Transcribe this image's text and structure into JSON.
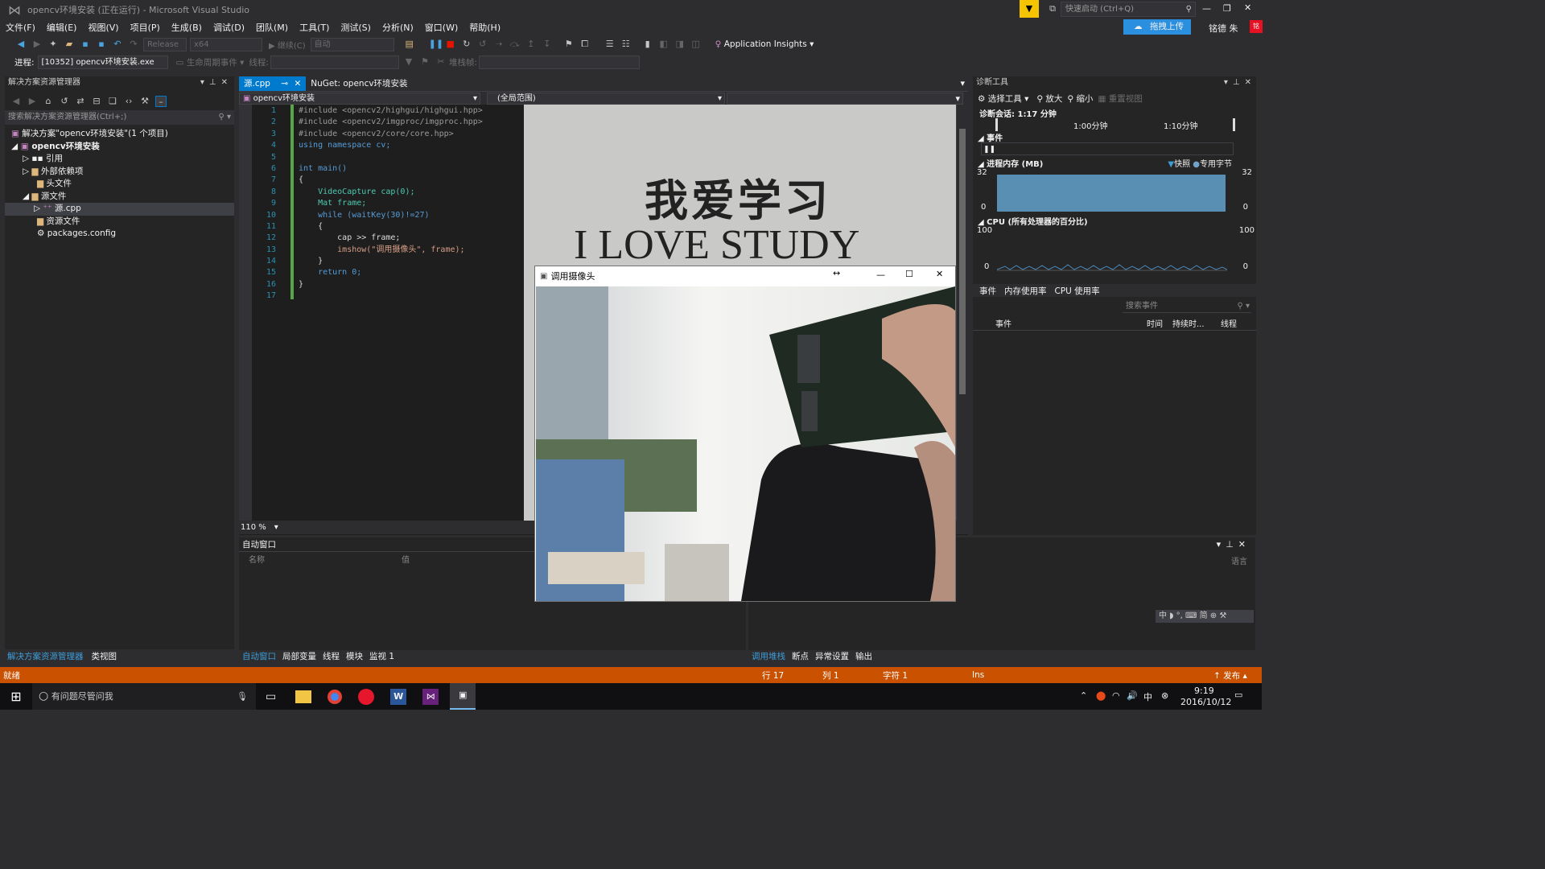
{
  "window_title": "opencv环境安装 (正在运行) - Microsoft Visual Studio",
  "quick_launch_placeholder": "快速启动 (Ctrl+Q)",
  "drag_upload": "拖拽上传",
  "user_name": "铭德 朱",
  "menu": [
    "文件(F)",
    "编辑(E)",
    "视图(V)",
    "项目(P)",
    "生成(B)",
    "调试(D)",
    "团队(M)",
    "工具(T)",
    "测试(S)",
    "分析(N)",
    "窗口(W)",
    "帮助(H)"
  ],
  "toolbar": {
    "config": "Release",
    "platform": "x64",
    "continue": "继续(C)",
    "auto": "自动",
    "app_insights": "Application Insights"
  },
  "toolbar2": {
    "process_label": "进程:",
    "process": "[10352] opencv环境安装.exe",
    "lifecycle": "生命周期事件",
    "thread": "线程:",
    "stack": "堆栈帧:"
  },
  "solution_explorer": {
    "title": "解决方案资源管理器",
    "search_placeholder": "搜索解决方案资源管理器(Ctrl+;)",
    "items": [
      "解决方案\"opencv环境安装\"(1 个项目)",
      "opencv环境安装",
      "引用",
      "外部依赖项",
      "头文件",
      "源文件",
      "源.cpp",
      "资源文件",
      "packages.config"
    ],
    "bottom_tabs": [
      "解决方案资源管理器",
      "类视图"
    ]
  },
  "editor": {
    "tabs": [
      "源.cpp",
      "NuGet: opencv环境安装"
    ],
    "nav_left": "opencv环境安装",
    "nav_right": "(全局范围)",
    "line_numbers": [
      "1",
      "2",
      "3",
      "4",
      "5",
      "6",
      "7",
      "8",
      "9",
      "10",
      "11",
      "12",
      "13",
      "14",
      "15",
      "16",
      "17"
    ],
    "code": [
      "#include <opencv2/highgui/highgui.hpp>",
      "#include <opencv2/imgproc/imgproc.hpp>",
      "#include <opencv2/core/core.hpp>",
      "using namespace cv;",
      "",
      "int main()",
      "{",
      "    VideoCapture cap(0);",
      "    Mat frame;",
      "    while (waitKey(30)!=27)",
      "    {",
      "        cap >> frame;",
      "        imshow(\"调用摄像头\", frame);",
      "    }",
      "    return 0;",
      "}",
      ""
    ],
    "zoom": "110 %"
  },
  "image_text": {
    "cn": "我爱学习",
    "en": "I LOVE STUDY"
  },
  "camera_window": {
    "title": "调用摄像头"
  },
  "diagnostics": {
    "title": "诊断工具",
    "select_tool": "选择工具",
    "zoom_in": "放大",
    "zoom_out": "缩小",
    "reset_view": "重置视图",
    "session": "诊断会话: 1:17 分钟",
    "t1": "1:00分钟",
    "t2": "1:10分钟",
    "events": "事件",
    "memory": "进程内存 (MB)",
    "snapshot": "快照",
    "private_bytes": "专用字节",
    "mem_max": "32",
    "mem_min": "0",
    "cpu": "CPU (所有处理器的百分比)",
    "cpu_max": "100",
    "cpu_min": "0",
    "tabs": [
      "事件",
      "内存使用率",
      "CPU 使用率"
    ],
    "search_placeholder": "搜索事件",
    "columns": [
      "事件",
      "时间",
      "持续时...",
      "线程"
    ]
  },
  "autos": {
    "title": "自动窗口",
    "col_name": "名称",
    "col_value": "值",
    "bottom_tabs": [
      "自动窗口",
      "局部变量",
      "线程",
      "模块",
      "监视 1"
    ]
  },
  "callstack": {
    "col_lang": "语言",
    "bottom_tabs": [
      "调用堆栈",
      "断点",
      "异常设置",
      "输出"
    ]
  },
  "status": {
    "ready": "就绪",
    "line": "行 17",
    "col": "列 1",
    "char": "字符 1",
    "ins": "Ins",
    "publish": "发布"
  },
  "taskbar": {
    "search": "有问题尽管问我",
    "time": "9:19",
    "date": "2016/10/12",
    "ime": "中"
  },
  "colors": {
    "accent": "#007acc",
    "status": "#ca5100",
    "bg": "#2d2d30"
  }
}
